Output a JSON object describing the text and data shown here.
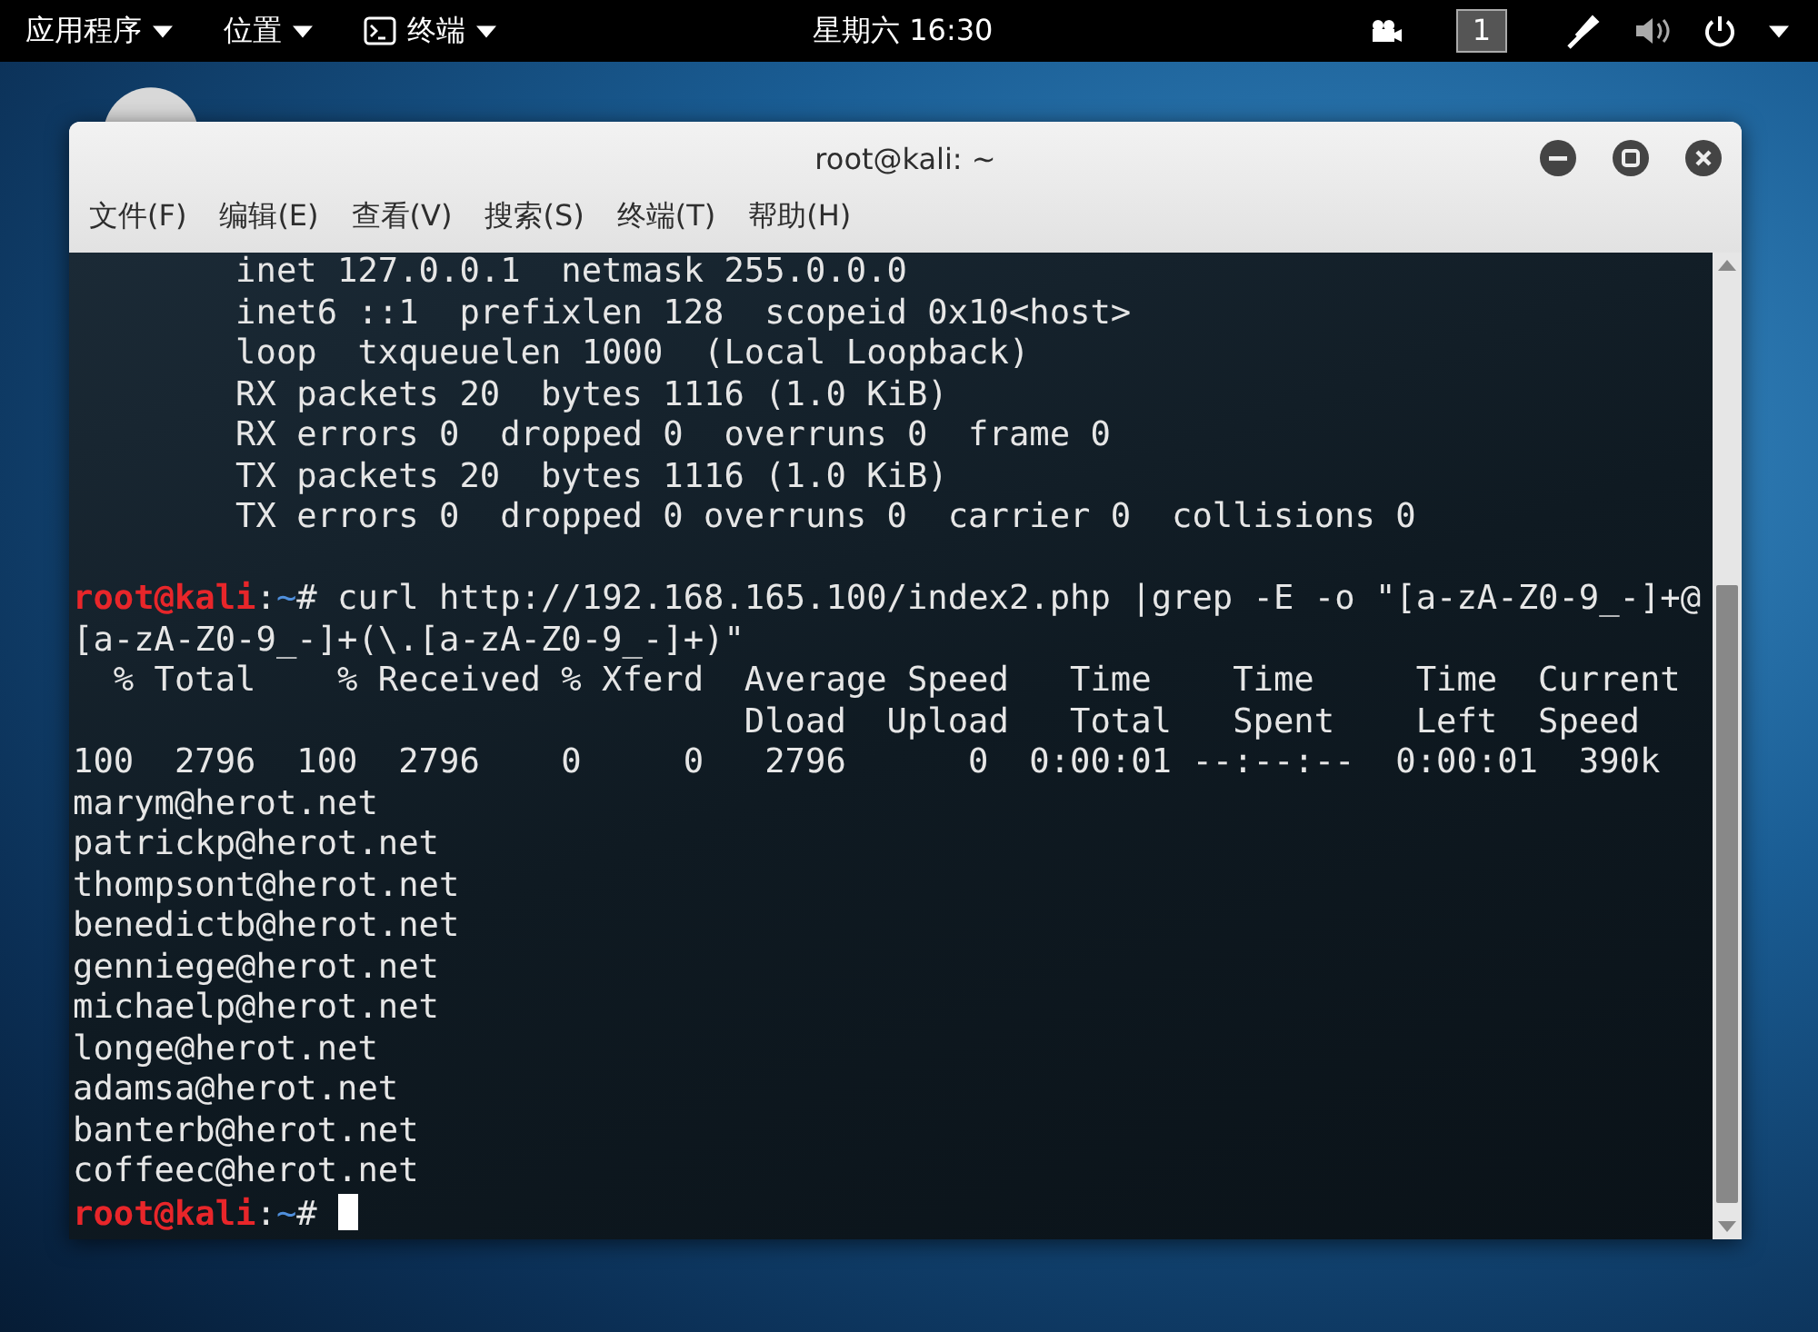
{
  "top_bar": {
    "menus": [
      {
        "label": "应用程序",
        "kind": "plain"
      },
      {
        "label": "位置",
        "kind": "plain"
      },
      {
        "label": "终端",
        "kind": "app"
      }
    ],
    "clock": "星期六 16:30",
    "workspace": "1"
  },
  "window": {
    "title": "root@kali: ~",
    "menu": [
      "文件(F)",
      "编辑(E)",
      "查看(V)",
      "搜索(S)",
      "终端(T)",
      "帮助(H)"
    ]
  },
  "terminal": {
    "lines": [
      {
        "kind": "output",
        "text": "        inet 127.0.0.1  netmask 255.0.0.0"
      },
      {
        "kind": "output",
        "text": "        inet6 ::1  prefixlen 128  scopeid 0x10<host>"
      },
      {
        "kind": "output",
        "text": "        loop  txqueuelen 1000  (Local Loopback)"
      },
      {
        "kind": "output",
        "text": "        RX packets 20  bytes 1116 (1.0 KiB)"
      },
      {
        "kind": "output",
        "text": "        RX errors 0  dropped 0  overruns 0  frame 0"
      },
      {
        "kind": "output",
        "text": "        TX packets 20  bytes 1116 (1.0 KiB)"
      },
      {
        "kind": "output",
        "text": "        TX errors 0  dropped 0 overruns 0  carrier 0  collisions 0"
      },
      {
        "kind": "blank"
      },
      {
        "kind": "prompt",
        "user": "root@kali",
        "sep": ":",
        "path": "~",
        "command": "# curl http://192.168.165.100/index2.php |grep -E -o \"[a-zA-Z0-9_-]+@"
      },
      {
        "kind": "output",
        "text": "[a-zA-Z0-9_-]+(\\.[a-zA-Z0-9_-]+)\""
      },
      {
        "kind": "output",
        "text": "  % Total    % Received % Xferd  Average Speed   Time    Time     Time  Current"
      },
      {
        "kind": "output",
        "text": "                                 Dload  Upload   Total   Spent    Left  Speed"
      },
      {
        "kind": "output",
        "text": "100  2796  100  2796    0     0   2796      0  0:00:01 --:--:--  0:00:01  390k"
      },
      {
        "kind": "output",
        "text": "marym@herot.net"
      },
      {
        "kind": "output",
        "text": "patrickp@herot.net"
      },
      {
        "kind": "output",
        "text": "thompsont@herot.net"
      },
      {
        "kind": "output",
        "text": "benedictb@herot.net"
      },
      {
        "kind": "output",
        "text": "genniege@herot.net"
      },
      {
        "kind": "output",
        "text": "michaelp@herot.net"
      },
      {
        "kind": "output",
        "text": "longe@herot.net"
      },
      {
        "kind": "output",
        "text": "adamsa@herot.net"
      },
      {
        "kind": "output",
        "text": "banterb@herot.net"
      },
      {
        "kind": "output",
        "text": "coffeec@herot.net"
      },
      {
        "kind": "prompt",
        "user": "root@kali",
        "sep": ":",
        "path": "~",
        "command": "# ",
        "cursor": true
      }
    ]
  }
}
